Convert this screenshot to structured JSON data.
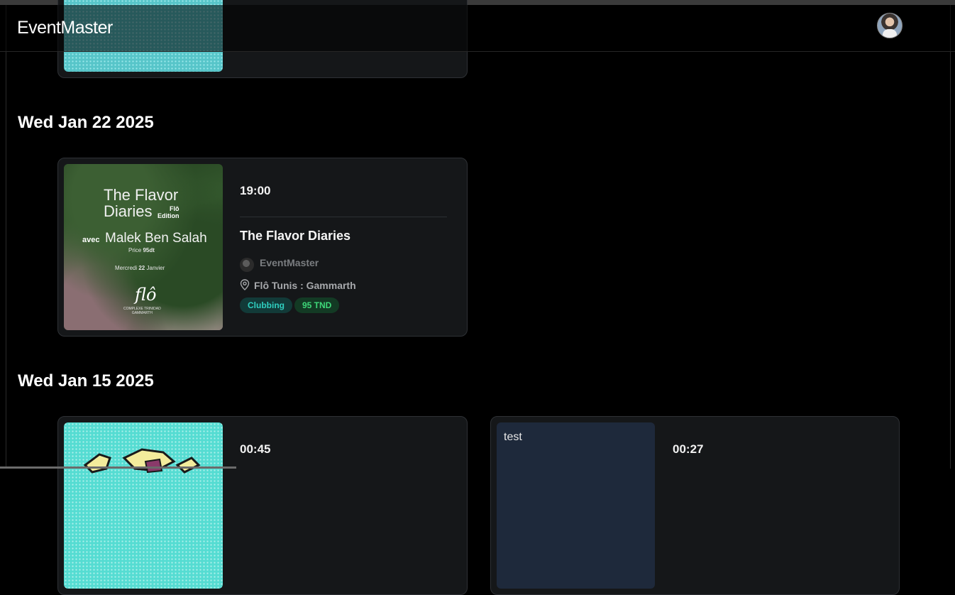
{
  "app": {
    "brand": "EventMaster"
  },
  "sections": [
    {
      "date": "Wed Jan 22 2025",
      "events": [
        {
          "time": "19:00",
          "title": "The Flavor Diaries",
          "organizer": "EventMaster",
          "location": "Flô Tunis : Gammarth",
          "genre": "Clubbing",
          "price": "95 TND",
          "poster": {
            "title": "The Flavor Diaries",
            "edition_line1": "Flô",
            "edition_line2": "Edition",
            "avec": "avec",
            "artist": "Malek Ben Salah",
            "price_label": "Price",
            "price_value": "95dt",
            "date_day": "Mercredi",
            "date_num": "22",
            "date_month": "Janvier",
            "logo": "flô",
            "venue_line1": "COMPLEXE TRINIDAD",
            "venue_line2": "GAMMARTH"
          }
        }
      ]
    },
    {
      "date": "Wed Jan 15 2025",
      "events": [
        {
          "time": "00:45"
        },
        {
          "time": "00:27",
          "image_alt": "test"
        }
      ]
    }
  ],
  "colors": {
    "background": "#000000",
    "card": "#151719",
    "genre_tag_text": "#2fcfc0",
    "price_tag_text": "#3ed879"
  }
}
